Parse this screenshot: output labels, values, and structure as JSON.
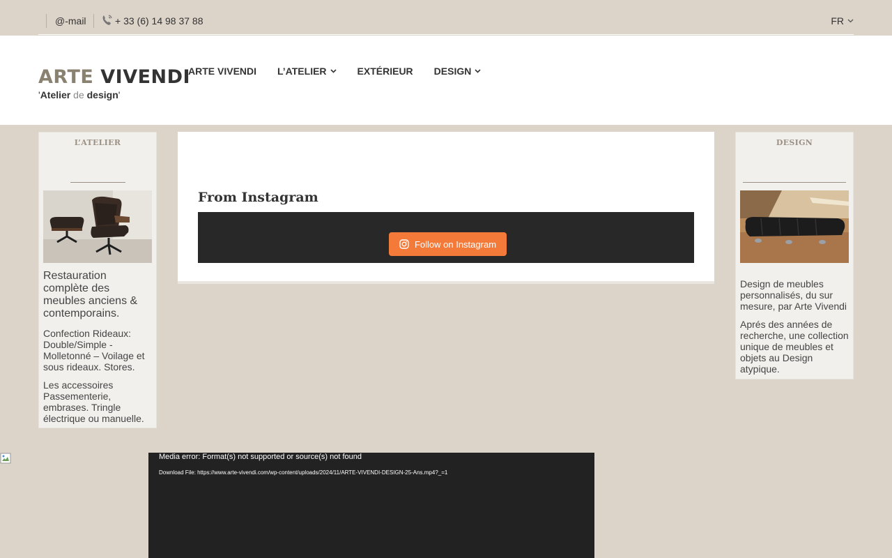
{
  "topbar": {
    "mail": "@-mail",
    "phone": "+ 33 (6) 14 98 37 88",
    "lang": "FR"
  },
  "logo": {
    "word1": "ARTE",
    "word2": "VIVENDI",
    "tag_q1": "'",
    "tag_b1": "Atelier",
    "tag_de": " de ",
    "tag_b2": "design",
    "tag_q2": "'"
  },
  "nav": [
    {
      "label": "ARTE VIVENDI",
      "dropdown": false
    },
    {
      "label": "L’ATELIER",
      "dropdown": true
    },
    {
      "label": "EXTÉRIEUR",
      "dropdown": false
    },
    {
      "label": "DESIGN",
      "dropdown": true
    }
  ],
  "left_widget": {
    "title": "L’ATELIER",
    "heading": "Restauration complète des meubles anciens & contemporains.",
    "p1": "Confection Rideaux: Double/Simple - Molletonné – Voilage et sous rideaux. Stores.",
    "p2": "Les accessoires Passementerie, embrases. Tringle électrique ou manuelle."
  },
  "right_widget": {
    "title": "DESIGN",
    "p1": "Design de meubles personnalisés, du sur mesure, par Arte Vivendi",
    "p2": "Aprés des années de recherche, une collection unique de meubles et objets au Design atypique."
  },
  "instagram": {
    "title": "From Instagram",
    "button": "Follow on Instagram"
  },
  "video": {
    "error": "Media error: Format(s) not supported or source(s) not found",
    "download": "Download File: https://www.arte-vivendi.com/wp-content/uploads/2024/11/ARTE-VIVENDI-DESIGN-25-Ans.mp4?_=1"
  },
  "colors": {
    "background": "#dcd3c9",
    "accent_button": "#f47a3a",
    "logo_accent": "#8a8270"
  }
}
